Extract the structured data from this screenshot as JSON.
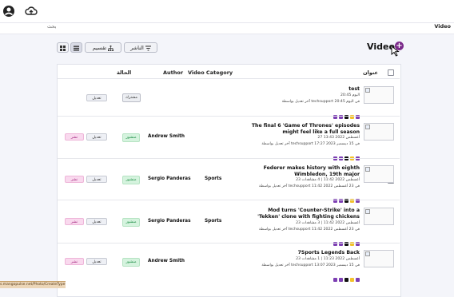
{
  "topbar": {
    "user_icon": "user-circle-icon",
    "cloud_icon": "cloud-upload-icon"
  },
  "path": {
    "left_text": "بحث",
    "right_text": "Video"
  },
  "page": {
    "title": "Video",
    "add_symbol": "+"
  },
  "toolbar": {
    "publisher_label": "الناشر",
    "split_label": "تقسيم"
  },
  "table": {
    "headers": {
      "title": "عنوان",
      "category": "Video Category",
      "author": "Author",
      "status": "الحالة"
    },
    "rows": [
      {
        "title": "test",
        "meta1": "اليوم 20:45",
        "meta2": "آخر تعديل بواسطة techsupport في اليوم 20:45",
        "category": "",
        "author": "",
        "status": "مشترك",
        "status_type": "draft",
        "edit_label": "تعديل",
        "publish_label": ""
      },
      {
        "title": "The final 6 'Game of Thrones' episodes might feel like a full season",
        "meta1": "27 أغسطس 2022 13:43",
        "meta2": "آخر تعديل بواسطة techsupport في 15 ديسمبر 2023 17:27",
        "category": "",
        "author": "Andrew Smith",
        "status": "منشور",
        "status_type": "pub",
        "edit_label": "تعديل",
        "publish_label": "نشر"
      },
      {
        "title": "Federer makes history with eighth Wimbledon, 19th major",
        "meta1": "23 أغسطس 2022 11:42  |  4 مشاهدات",
        "meta2": "آخر تعديل بواسطة techsupport في 23 أغسطس 2022 11:42",
        "category": "Sports",
        "author": "Sergio Panderas",
        "status": "منشور",
        "status_type": "pub",
        "edit_label": "تعديل",
        "publish_label": "نشر"
      },
      {
        "title": "Mod turns 'Counter-Strike' into a 'Tekken' clone with fighting chickens",
        "meta1": "23 أغسطس 2022 11:42  |  3 مشاهدات",
        "meta2": "آخر تعديل بواسطة techsupport في 23 أغسطس 2022 11:42",
        "category": "Sports",
        "author": "Sergio Panderas",
        "status": "منشور",
        "status_type": "pub",
        "edit_label": "تعديل",
        "publish_label": "نشر"
      },
      {
        "title": "7Sports Legends Back",
        "meta1": "23 أغسطس 2022 11:23  |  1 مشاهدات",
        "meta2": "آخر تعديل بواسطة techsupport في 15 ديسمبر 2023 13:07",
        "category": "",
        "author": "Andrew Smith",
        "status": "منشور",
        "status_type": "pub",
        "edit_label": "تعديل",
        "publish_label": "نشر"
      }
    ]
  },
  "statusbar": {
    "url": "s.mangopulse.net/Photo/CreateType-video"
  },
  "colors": {
    "accent": "#7a2a8a",
    "published_bg": "#d5f3de",
    "publish_btn_bg": "#f9d9ee"
  }
}
